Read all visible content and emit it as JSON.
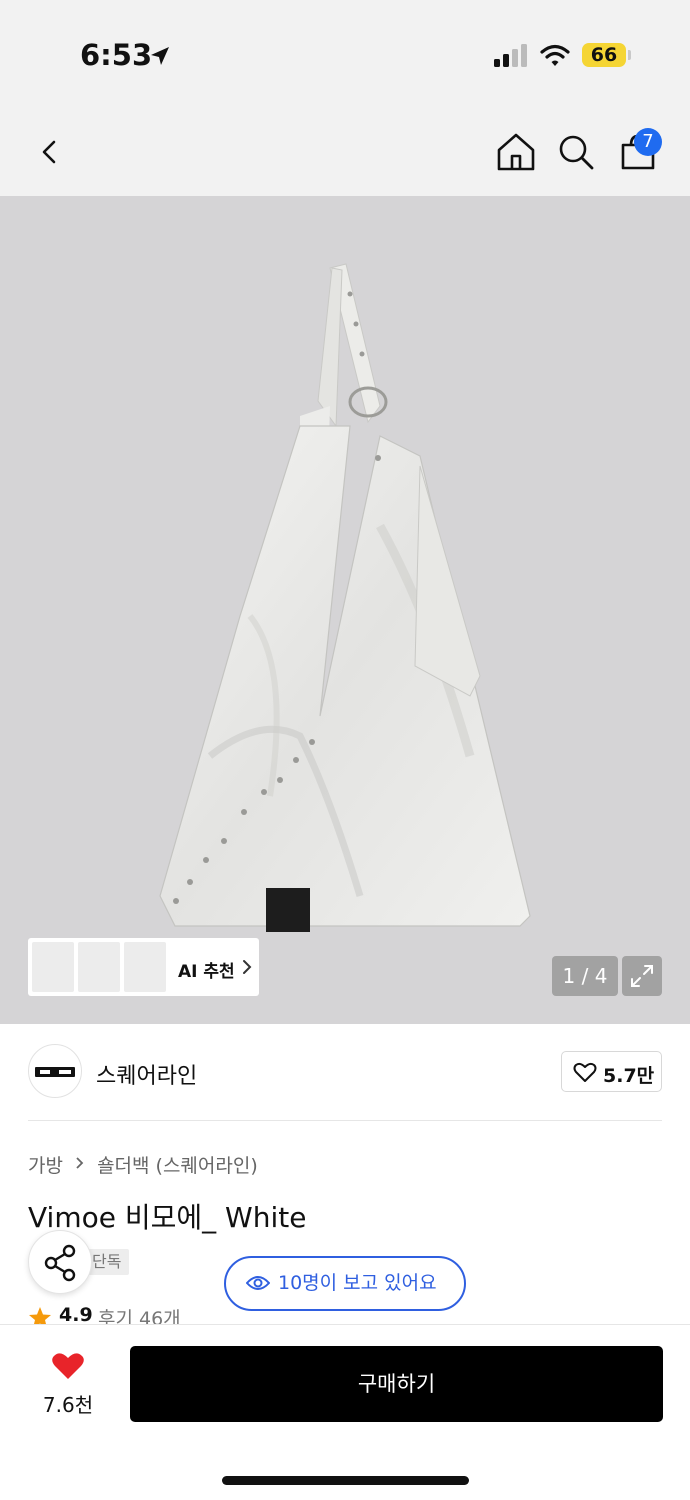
{
  "status_bar": {
    "time": "6:53",
    "battery": "66",
    "icons": [
      "location-arrow-icon",
      "signal-icon",
      "wifi-icon",
      "battery-icon"
    ]
  },
  "nav": {
    "icons": [
      "back-icon",
      "home-icon",
      "search-icon",
      "shopping-bag-icon"
    ],
    "cart_badge": "7"
  },
  "gallery": {
    "ai_label": "AI 추천",
    "page_counter": "1 / 4"
  },
  "brand": {
    "name": "스퀘어라인",
    "likes": "5.7만"
  },
  "product": {
    "breadcrumb": [
      "가방",
      "숄더백 (스퀘어라인)"
    ],
    "title": "Vimoe 비모에_ White",
    "tag": "단독",
    "viewers": "10명이 보고 있어요",
    "rating": "4.9",
    "reviews": "후기 46개"
  },
  "bottom_bar": {
    "wish_count": "7.6천",
    "buy_label": "구매하기"
  },
  "colors": {
    "accent_blue": "#2f5fe0",
    "badge_blue": "#1f6bf0",
    "heart_red": "#e8242a",
    "star_orange": "#f59a0c",
    "battery_yellow": "#f5d534",
    "image_bg": "#d5d4d6"
  }
}
